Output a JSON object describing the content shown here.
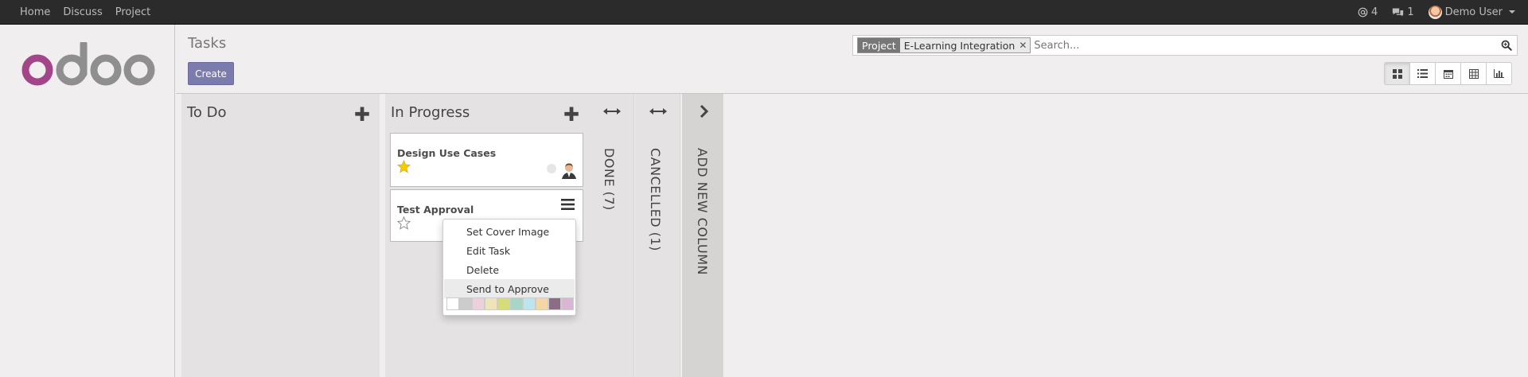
{
  "topbar": {
    "nav": [
      "Home",
      "Discuss",
      "Project"
    ],
    "mentions_count": "4",
    "messages_count": "1",
    "user_name": "Demo User"
  },
  "control": {
    "breadcrumb": "Tasks",
    "create_label": "Create",
    "search": {
      "facet_category": "Project",
      "facet_value": "E-Learning Integration",
      "placeholder": "Search..."
    },
    "views": [
      "kanban-icon",
      "list-icon",
      "calendar-icon",
      "pivot-icon",
      "graph-icon"
    ]
  },
  "kanban": {
    "columns": [
      {
        "title": "To Do",
        "cards": []
      },
      {
        "title": "In Progress",
        "cards": [
          {
            "title": "Design Use Cases",
            "starred": true
          },
          {
            "title": "Test Approval",
            "starred": false
          }
        ]
      }
    ],
    "folded": [
      {
        "title": "DONE (7)"
      },
      {
        "title": "CANCELLED (1)"
      }
    ],
    "add_column_label": "ADD NEW COLUMN"
  },
  "menu": {
    "items": [
      "Set Cover Image",
      "Edit Task",
      "Delete",
      "Send to Approve"
    ],
    "colors": [
      "#ffffff",
      "#cccccc",
      "#ecd0dc",
      "#efe4b7",
      "#d6dc78",
      "#a8d5c6",
      "#bde5ed",
      "#f5d6a5",
      "#8b6d85",
      "#d8b6d4"
    ]
  },
  "colors": {
    "topbar_bg": "#2b2b2b",
    "primary_button": "#7c7bad",
    "star_active": "#f3cc00"
  }
}
